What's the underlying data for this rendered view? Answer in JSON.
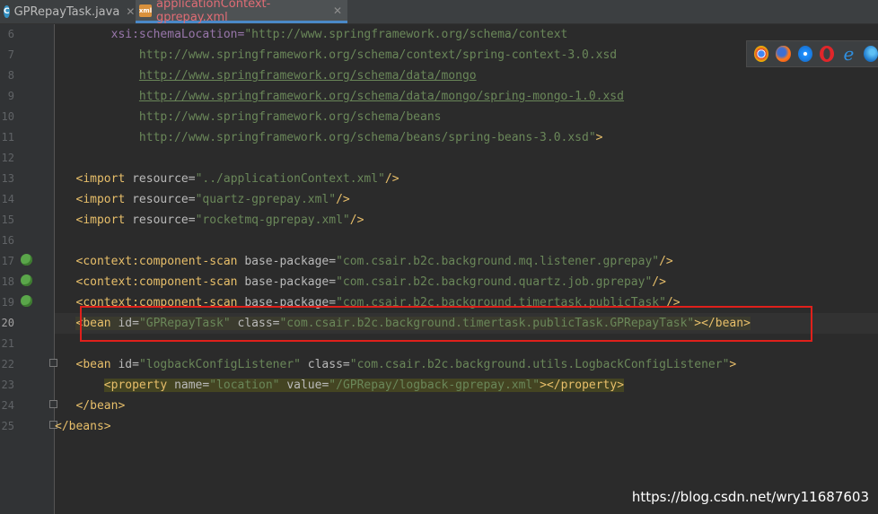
{
  "tabs": [
    {
      "label": "GPRepayTask.java",
      "icon": "java-class-icon"
    },
    {
      "label": "applicationContext-gprepay.xml",
      "icon": "xml-file-icon",
      "active": true
    }
  ],
  "line_numbers": [
    "6",
    "7",
    "8",
    "9",
    "10",
    "11",
    "12",
    "13",
    "14",
    "15",
    "16",
    "17",
    "18",
    "19",
    "20",
    "21",
    "22",
    "23",
    "24",
    "25"
  ],
  "code": {
    "l6_attr": "xsi:schemaLocation=",
    "l6_str": "\"http://www.springframework.org/schema/context",
    "l7": "http://www.springframework.org/schema/context/spring-context-3.0.xsd",
    "l8": "http://www.springframework.org/schema/data/mongo",
    "l9": "http://www.springframework.org/schema/data/mongo/spring-mongo-1.0.xsd",
    "l10": "http://www.springframework.org/schema/beans",
    "l11": "http://www.springframework.org/schema/beans/spring-beans-3.0.xsd\"",
    "l13_res": "\"../applicationContext.xml\"",
    "l14_res": "\"quartz-gprepay.xml\"",
    "l15_res": "\"rocketmq-gprepay.xml\"",
    "l17_pkg": "\"com.csair.b2c.background.mq.listener.gprepay\"",
    "l18_pkg": "\"com.csair.b2c.background.quartz.job.gprepay\"",
    "l19_pkg": "\"com.csair.b2c.background.timertask.publicTask\"",
    "l20_id": "\"GPRepayTask\"",
    "l20_class": "\"com.csair.b2c.background.timertask.publicTask.GPRepayTask\"",
    "l22_id": "\"logbackConfigListener\"",
    "l22_class": "\"com.csair.b2c.background.utils.LogbackConfigListener\"",
    "l23_name": "\"location\"",
    "l23_value": "\"/GPRepay/logback-gprepay.xml\"",
    "kw_import": "import",
    "kw_resource": "resource=",
    "kw_ctx": "context:component-scan",
    "kw_basepkg": "base-package=",
    "kw_bean": "bean",
    "kw_id": "id=",
    "kw_class": "class=",
    "kw_property": "property",
    "kw_name": "name=",
    "kw_value": "value=",
    "kw_beans": "beans"
  },
  "browsers": [
    "chrome-icon",
    "firefox-icon",
    "safari-icon",
    "opera-icon",
    "ie-icon",
    "edge-icon"
  ],
  "watermark": "https://blog.csdn.net/wry11687603"
}
